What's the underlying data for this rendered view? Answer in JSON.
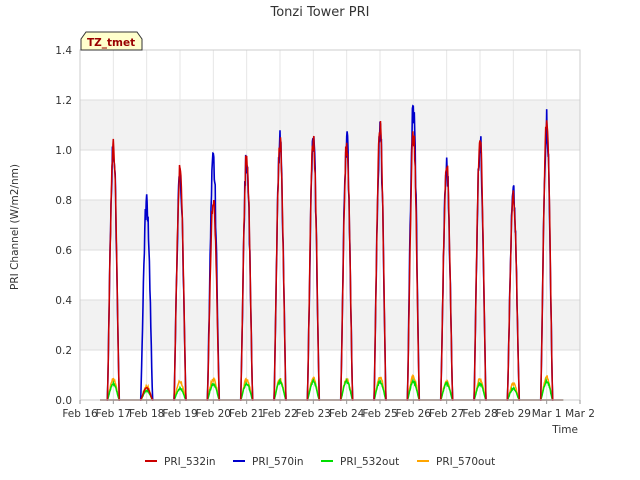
{
  "chart_data": {
    "type": "line",
    "title": "Tonzi Tower PRI",
    "xlabel": "Time",
    "ylabel": "PRI Channel (W/m2/nm)",
    "ylim": [
      0,
      1.4
    ],
    "yticks": [
      "0.0",
      "0.2",
      "0.4",
      "0.6",
      "0.8",
      "1.0",
      "1.2",
      "1.4"
    ],
    "xlim": [
      "Feb 16",
      "Mar 2"
    ],
    "xticks": [
      "Feb 16",
      "Feb 17",
      "Feb 18",
      "Feb 19",
      "Feb 20",
      "Feb 21",
      "Feb 22",
      "Feb 23",
      "Feb 24",
      "Feb 25",
      "Feb 26",
      "Feb 27",
      "Feb 28",
      "Feb 29",
      "Mar 1",
      "Mar 2"
    ],
    "grid": true,
    "legend_position": "bottom",
    "annotation": "TZ_tmet",
    "series": [
      {
        "name": "PRI_532in",
        "color": "#cc0000",
        "daily_peaks": [
          1.05,
          0.05,
          0.95,
          0.83,
          1.02,
          1.07,
          1.08,
          1.06,
          1.14,
          1.1,
          0.98,
          1.08,
          0.85,
          1.17
        ]
      },
      {
        "name": "PRI_570in",
        "color": "#0000cc",
        "daily_peaks": [
          1.07,
          0.84,
          0.95,
          1.01,
          1.03,
          1.08,
          1.09,
          1.11,
          1.14,
          1.23,
          0.99,
          1.1,
          0.87,
          1.18
        ]
      },
      {
        "name": "PRI_532out",
        "color": "#00dd00",
        "daily_peaks": [
          0.07,
          0.04,
          0.05,
          0.07,
          0.07,
          0.08,
          0.08,
          0.08,
          0.08,
          0.08,
          0.07,
          0.07,
          0.05,
          0.08
        ]
      },
      {
        "name": "PRI_570out",
        "color": "#ffa500",
        "daily_peaks": [
          0.09,
          0.06,
          0.08,
          0.09,
          0.09,
          0.09,
          0.09,
          0.09,
          0.1,
          0.1,
          0.08,
          0.09,
          0.07,
          0.1
        ]
      }
    ]
  }
}
